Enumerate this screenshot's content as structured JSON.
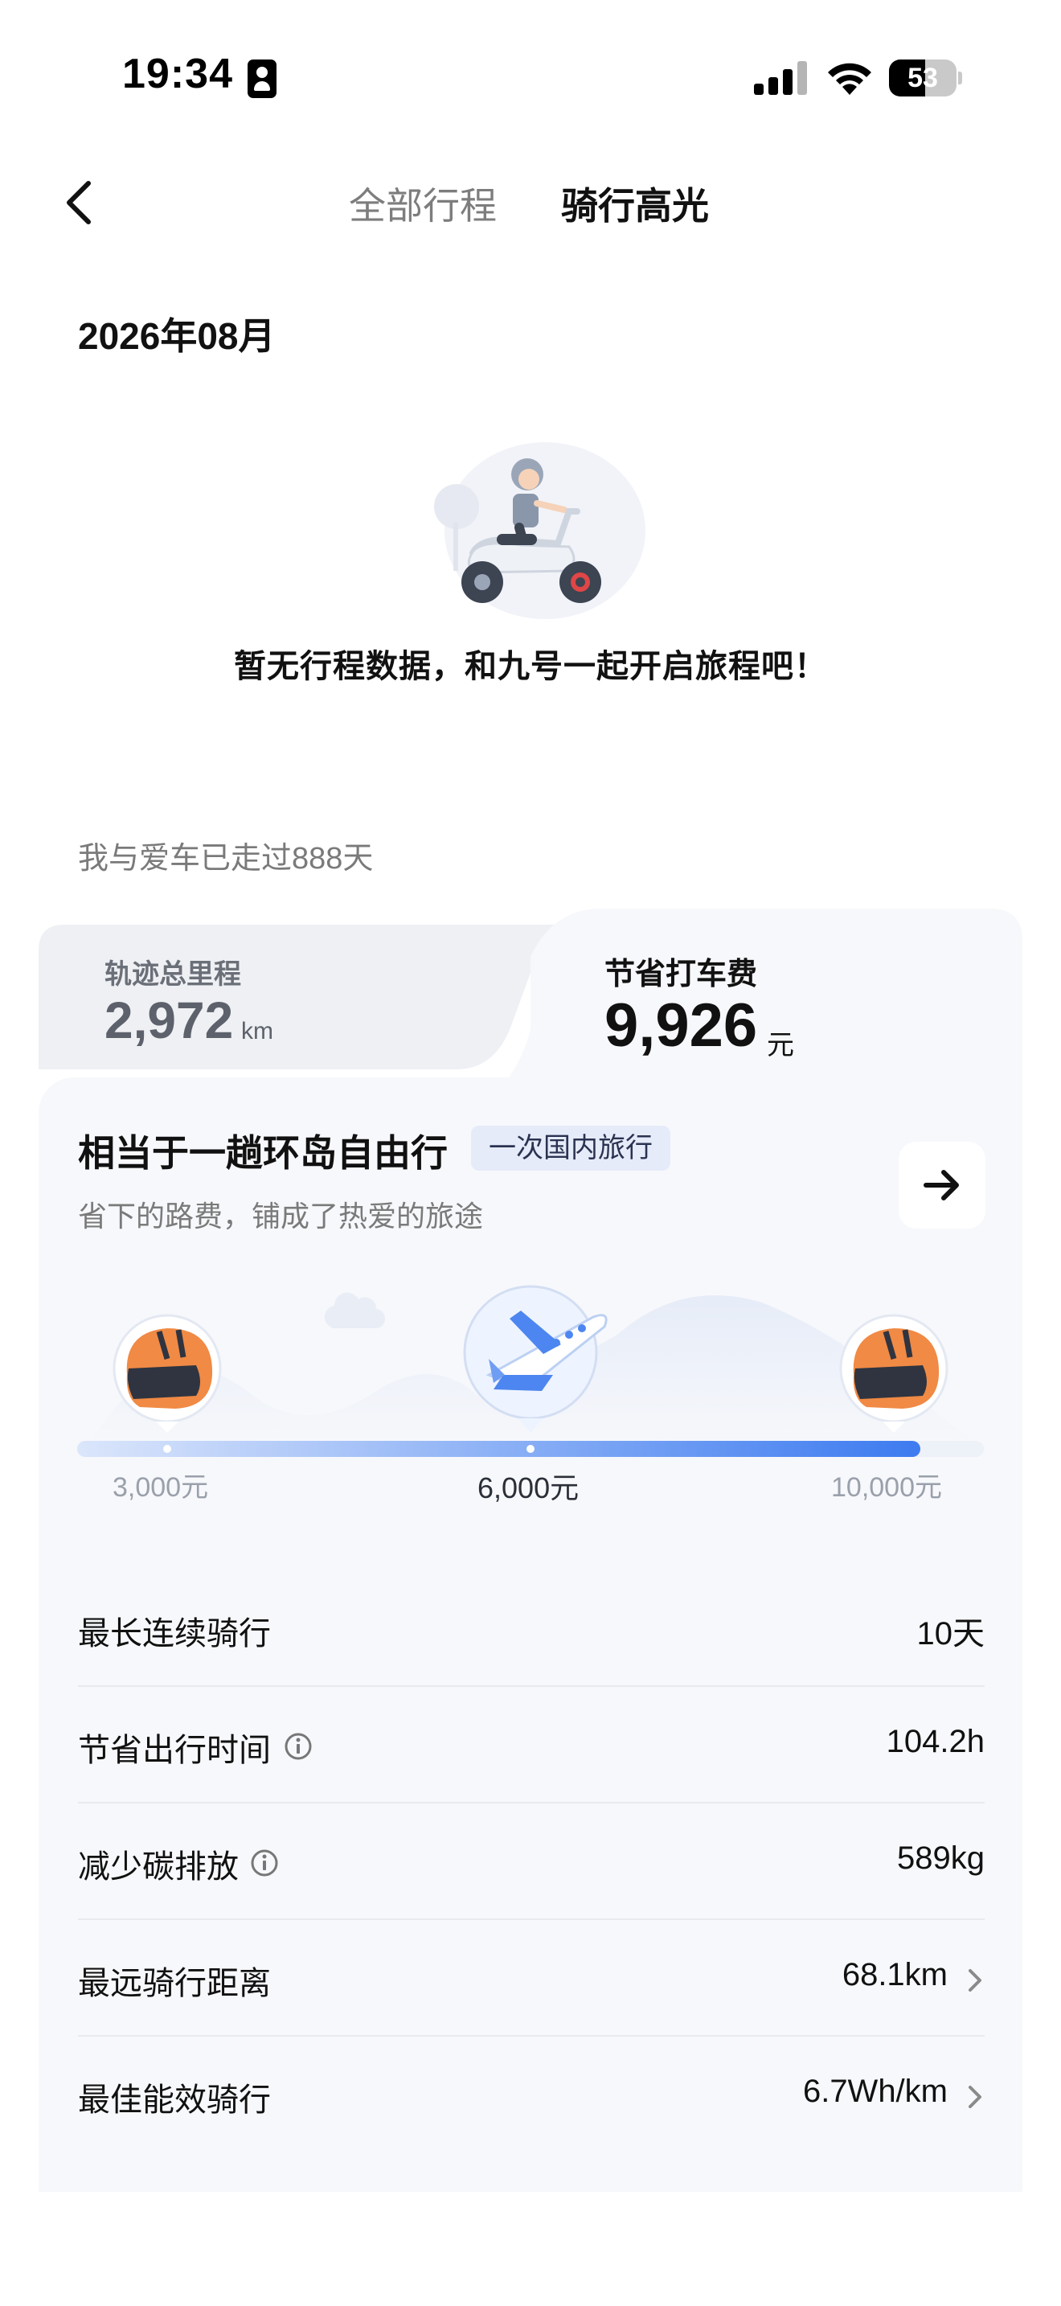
{
  "status_bar": {
    "time": "19:34",
    "battery": "53",
    "battery_level": 0.53
  },
  "nav": {
    "tab_all": "全部行程",
    "tab_highlight": "骑行高光"
  },
  "month": "2026年08月",
  "empty": {
    "message": "暂无行程数据，和九号一起开启旅程吧！"
  },
  "days_together": "我与爱车已走过888天",
  "stats": {
    "mileage_label": "轨迹总里程",
    "mileage_value": "2,972",
    "mileage_unit": "km",
    "saving_label": "节省打车费",
    "saving_value": "9,926",
    "saving_unit": "元"
  },
  "compare": {
    "title": "相当于一趟环岛自由行",
    "badge": "一次国内旅行",
    "subtitle": "省下的路费，铺成了热爱的旅途",
    "scale_left": "3,000元",
    "scale_mid": "6,000元",
    "scale_right": "10,000元",
    "progress": 0.93
  },
  "metrics": [
    {
      "label": "最长连续骑行",
      "value": "10天"
    },
    {
      "label": "节省出行时间",
      "value": "104.2h"
    },
    {
      "label": "减少碳排放",
      "value": "589kg"
    },
    {
      "label": "最远骑行距离",
      "value": "68.1km"
    },
    {
      "label": "最佳能效骑行",
      "value": "6.7Wh/km"
    }
  ],
  "colors": {
    "accent": "#3d7bf0",
    "helmet": "#f08a45",
    "card_bg": "#f7f8fb"
  }
}
